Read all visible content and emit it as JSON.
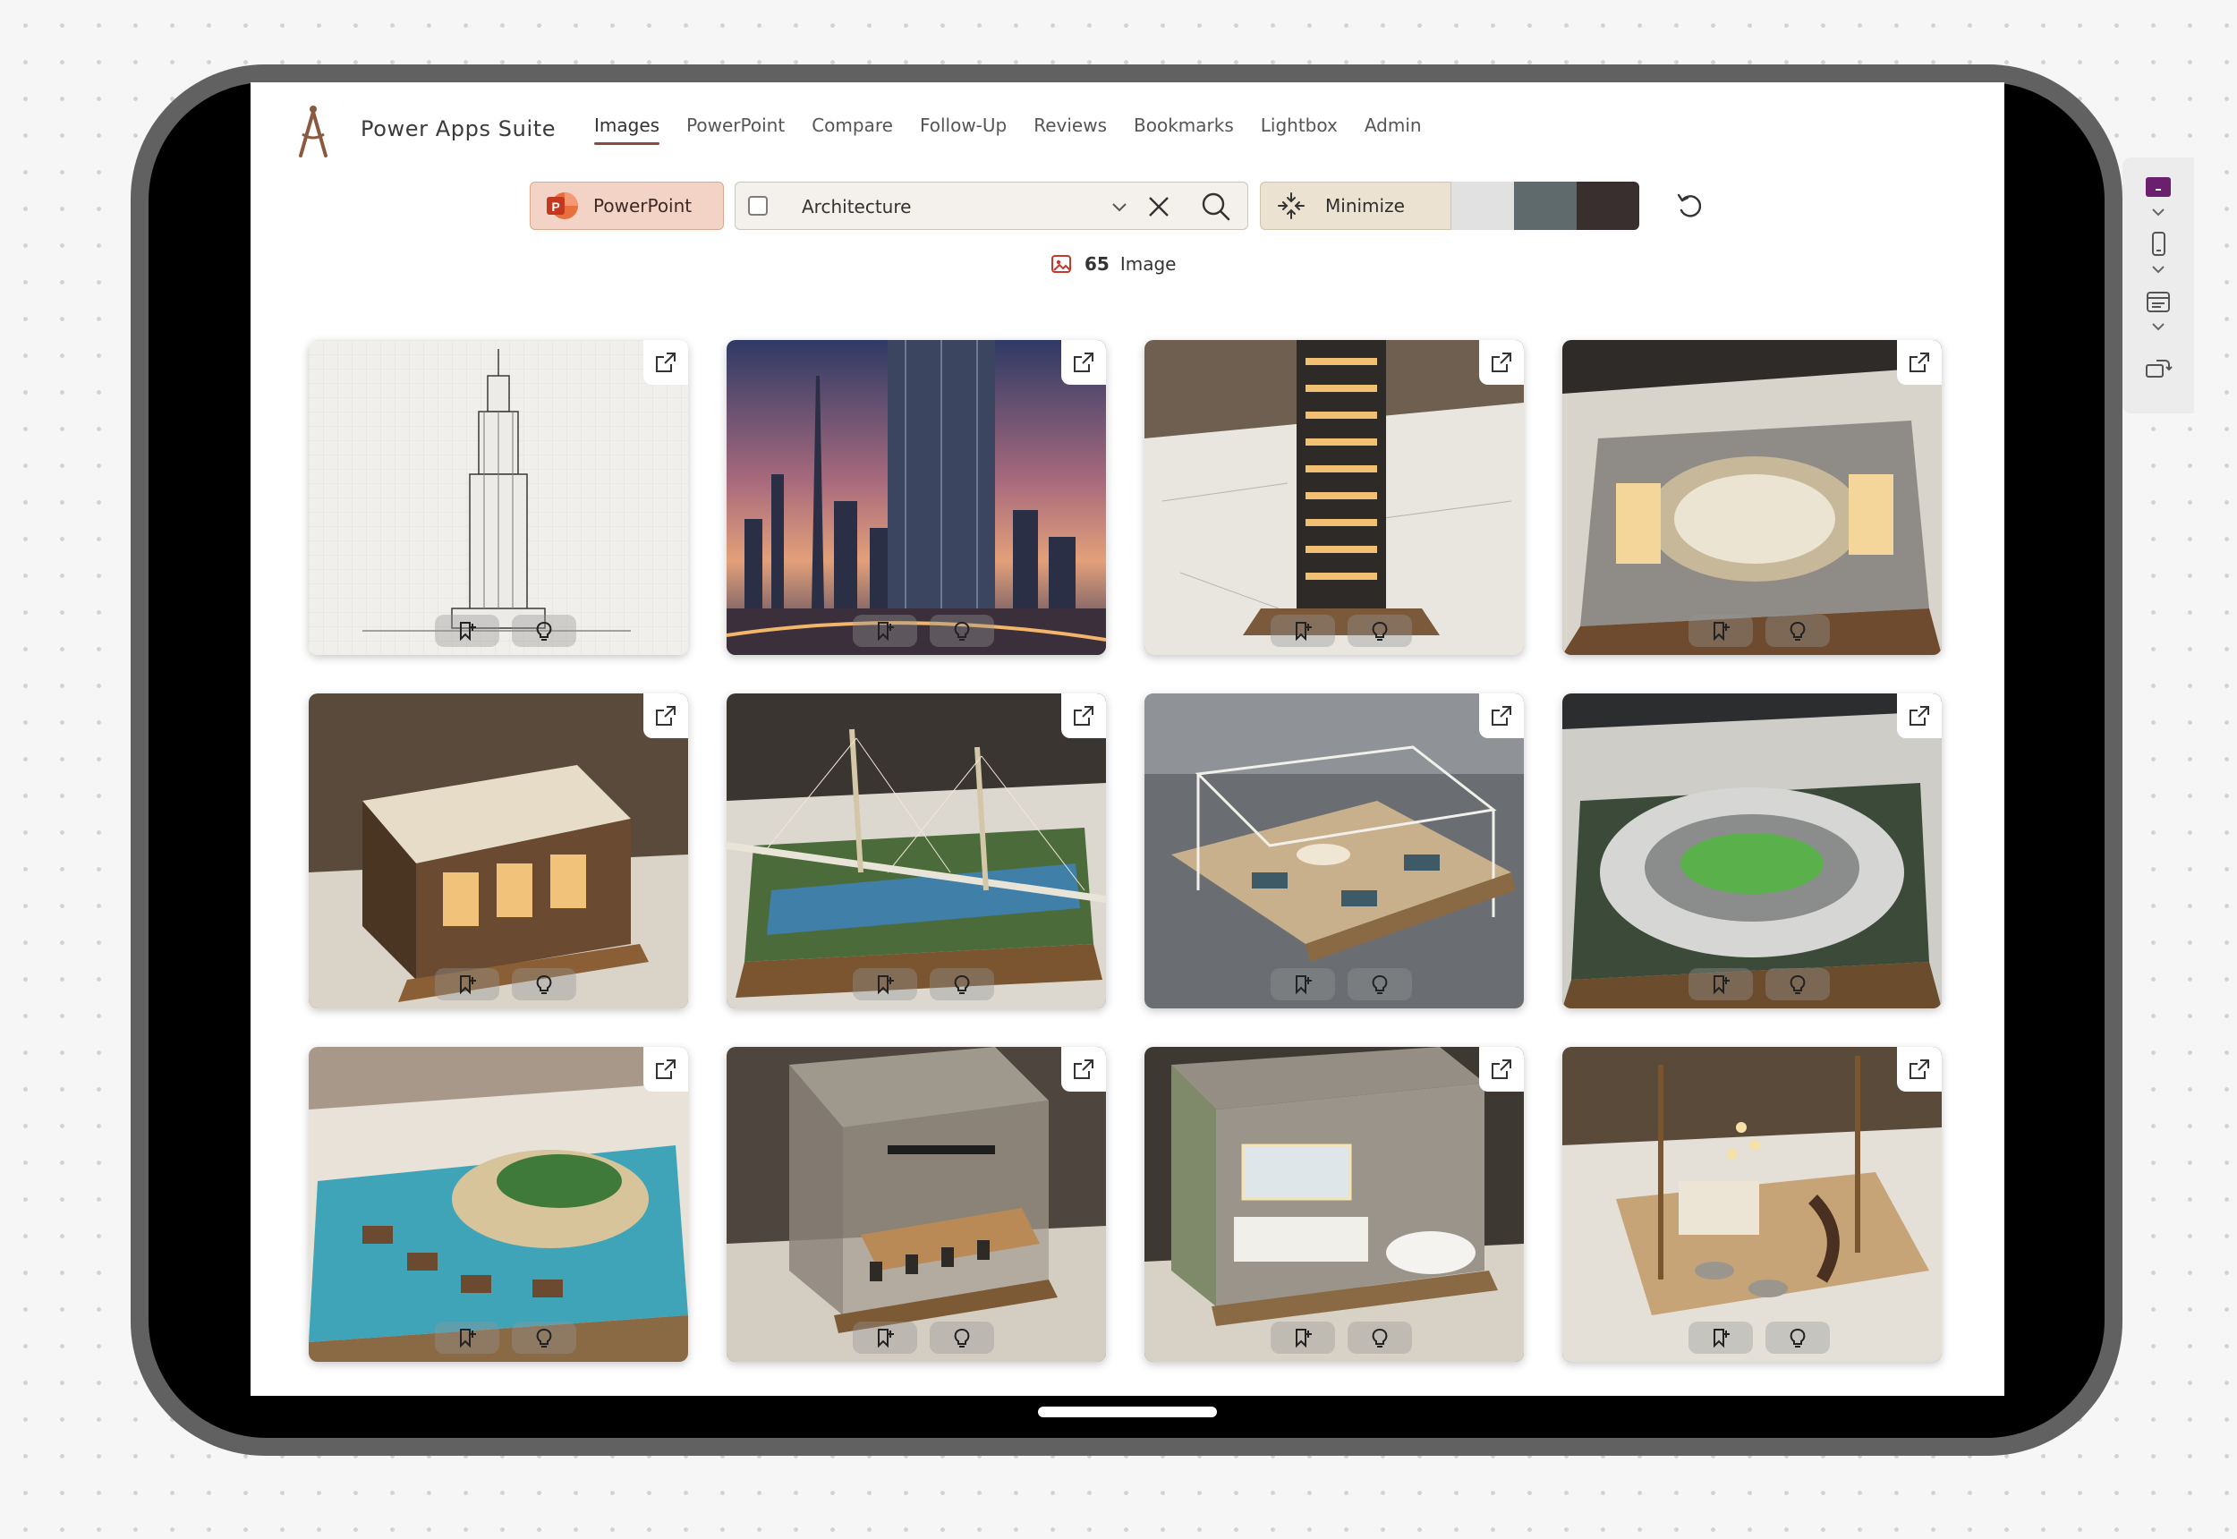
{
  "app": {
    "title": "Power Apps Suite"
  },
  "nav": {
    "items": [
      {
        "label": "Images",
        "active": true
      },
      {
        "label": "PowerPoint",
        "active": false
      },
      {
        "label": "Compare",
        "active": false
      },
      {
        "label": "Follow-Up",
        "active": false
      },
      {
        "label": "Reviews",
        "active": false
      },
      {
        "label": "Bookmarks",
        "active": false
      },
      {
        "label": "Lightbox",
        "active": false
      },
      {
        "label": "Admin",
        "active": false
      }
    ]
  },
  "toolbar": {
    "powerpoint_label": "PowerPoint",
    "search": {
      "value": "Architecture",
      "checked": false
    },
    "minimize_label": "Minimize",
    "swatch_colors": [
      "#e1e1e1",
      "#5f6a6d",
      "#3a2f2f"
    ],
    "accent": "#8a4b3c"
  },
  "results": {
    "count": "65",
    "label": "Image"
  },
  "images": [
    {
      "icon": "skyscraper-sketch"
    },
    {
      "icon": "city-skyline-dusk"
    },
    {
      "icon": "tower-model-on-blueprints"
    },
    {
      "icon": "shopping-mall-model"
    },
    {
      "icon": "coffee-shop-model"
    },
    {
      "icon": "cable-bridge-model"
    },
    {
      "icon": "office-interior-model"
    },
    {
      "icon": "stadium-model"
    },
    {
      "icon": "island-resort-model"
    },
    {
      "icon": "dining-room-model"
    },
    {
      "icon": "bathroom-model"
    },
    {
      "icon": "lobby-with-staircase-model"
    }
  ]
}
